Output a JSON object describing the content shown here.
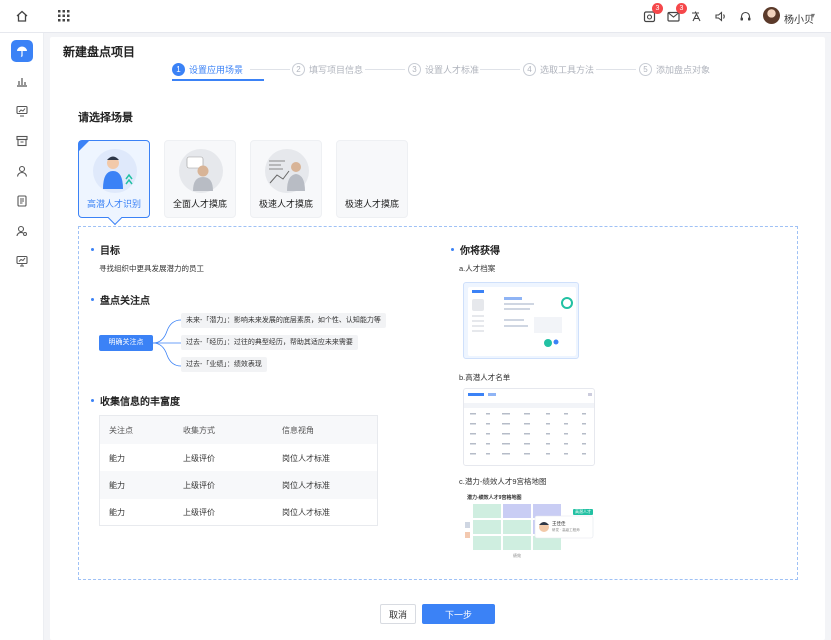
{
  "topbar": {
    "home_icon": "home-icon",
    "apps_icon": "grid-icon",
    "notification_badge": "3",
    "mail_badge": "3",
    "user_name": "杨小贝"
  },
  "sidebar": {
    "items": [
      "umbrella-icon",
      "bar-chart-icon",
      "monitor-chart-icon",
      "archive-icon",
      "person-icon",
      "document-icon",
      "user-search-icon",
      "presentation-icon"
    ]
  },
  "page": {
    "title": "新建盘点项目",
    "steps": [
      {
        "num": "1",
        "label": "设置应用场景"
      },
      {
        "num": "2",
        "label": "填写项目信息"
      },
      {
        "num": "3",
        "label": "设置人才标准"
      },
      {
        "num": "4",
        "label": "选取工具方法"
      },
      {
        "num": "5",
        "label": "添加盘点对象"
      }
    ],
    "section_title": "请选择场景",
    "scenarios": [
      "高潜人才识别",
      "全面人才摸底",
      "极速人才摸底",
      "极速人才摸底"
    ]
  },
  "detail": {
    "goal_title": "目标",
    "goal_text": "寻找组织中更具发展潜力的员工",
    "focus_title": "盘点关注点",
    "focus_root": "明确关注点",
    "focus_items": [
      "未来-「潜力」：影响未来发展的底层素质，如个性、认知能力等",
      "过去-「经历」：过往的典型经历，帮助其适应未来需要",
      "过去-「业绩」：绩效表现"
    ],
    "info_title": "收集信息的丰富度",
    "table": {
      "headers": [
        "关注点",
        "收集方式",
        "信息视角"
      ],
      "rows": [
        [
          "能力",
          "上级评价",
          "岗位人才标准"
        ],
        [
          "能力",
          "上级评价",
          "岗位人才标准"
        ],
        [
          "能力",
          "上级评价",
          "岗位人才标准"
        ]
      ]
    },
    "gain_title": "你将获得",
    "gains": [
      "a.人才档案",
      "b.高潜人才名单",
      "c.潜力-绩效人才9宫格地图"
    ],
    "grid_caption": "潜力-绩效人才9宫格地图",
    "grid_axis": "绩效",
    "popup_tag": "高潜人才",
    "popup_name": "王佳佳",
    "popup_sub": "研发 · 高级工程师"
  },
  "footer": {
    "cancel_label": "取消",
    "next_label": "下一步"
  },
  "colors": {
    "accent": "#3b82f6",
    "badge": "#f5474a"
  }
}
